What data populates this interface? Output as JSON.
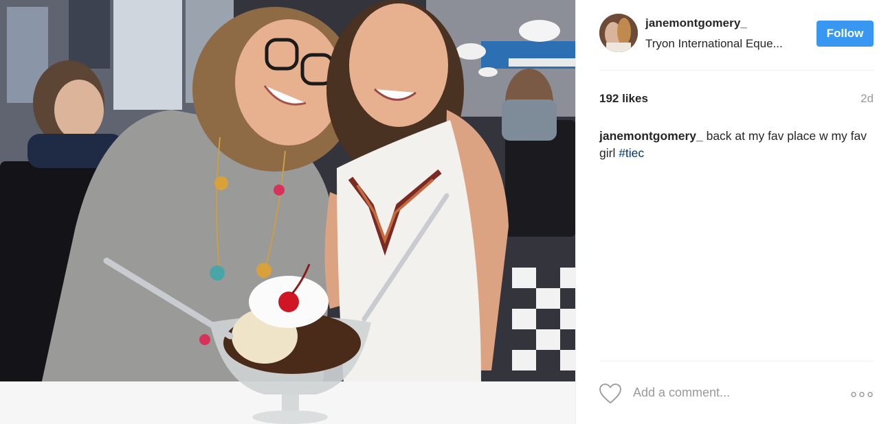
{
  "photo": {
    "alt": "Photo by janemontgomery_"
  },
  "header": {
    "username": "janemontgomery_",
    "location": "Tryon International Eque...",
    "follow_label": "Follow"
  },
  "meta": {
    "likes": "192 likes",
    "time_ago": "2d"
  },
  "caption": {
    "username": "janemontgomery_",
    "text": " back at my fav place w my fav girl ",
    "hashtag": "#tiec"
  },
  "footer": {
    "comment_placeholder": "Add a comment..."
  },
  "colors": {
    "accent": "#3897f0",
    "hashtag": "#003569",
    "muted": "#999999",
    "text": "#262626"
  },
  "icons": {
    "like": "heart-icon",
    "options": "more-options-icon"
  }
}
